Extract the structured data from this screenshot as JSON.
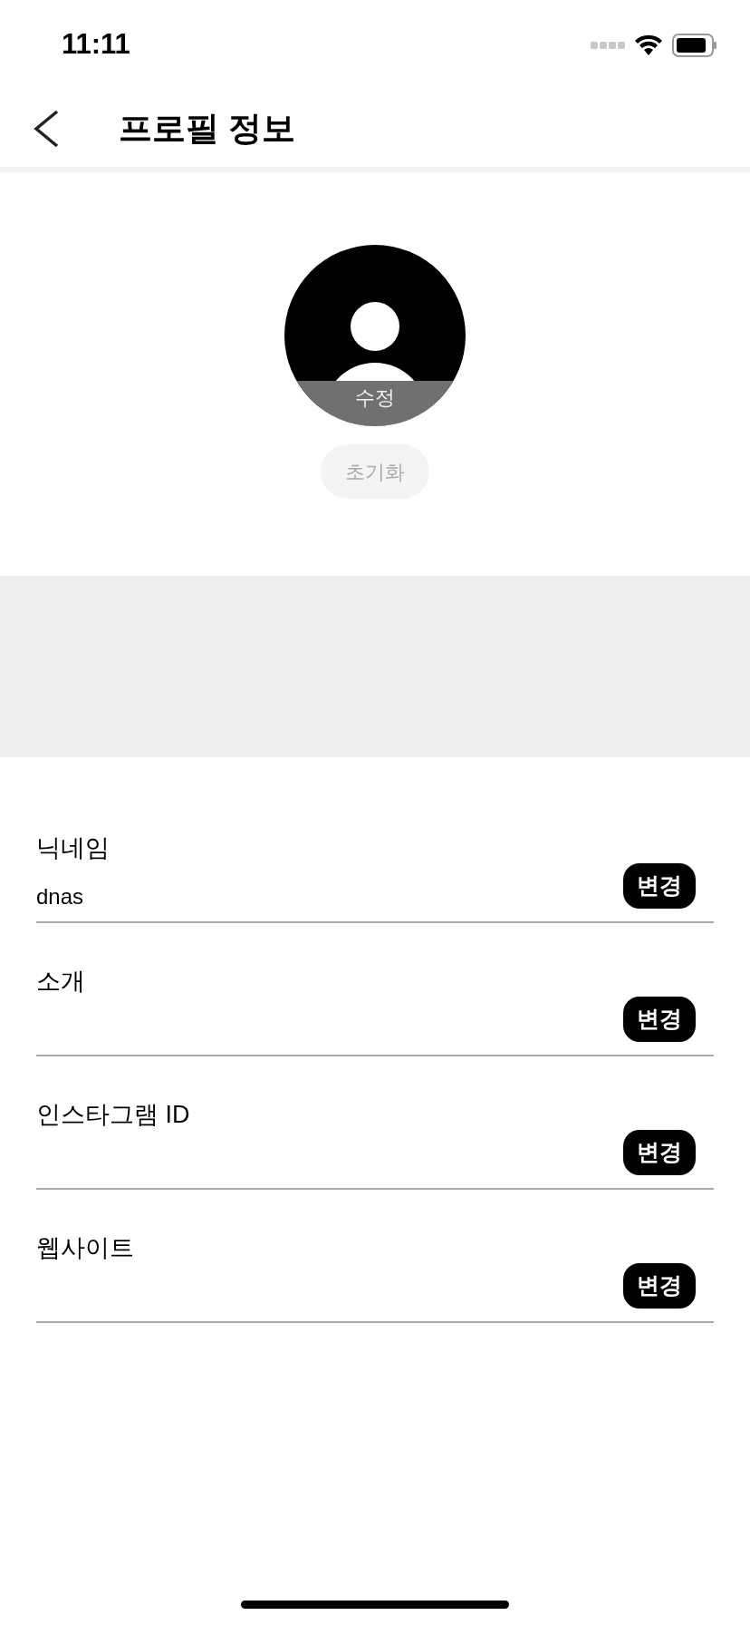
{
  "status_bar": {
    "time": "11:11"
  },
  "header": {
    "title": "프로필 정보"
  },
  "avatar": {
    "edit_label": "수정",
    "reset_button": "초기화"
  },
  "fields": [
    {
      "label": "닉네임",
      "value": "dnas",
      "button": "변경"
    },
    {
      "label": "소개",
      "button": "변경"
    },
    {
      "label": "인스타그램 ID",
      "button": "변경"
    },
    {
      "label": "웹사이트",
      "button": "변경"
    }
  ]
}
